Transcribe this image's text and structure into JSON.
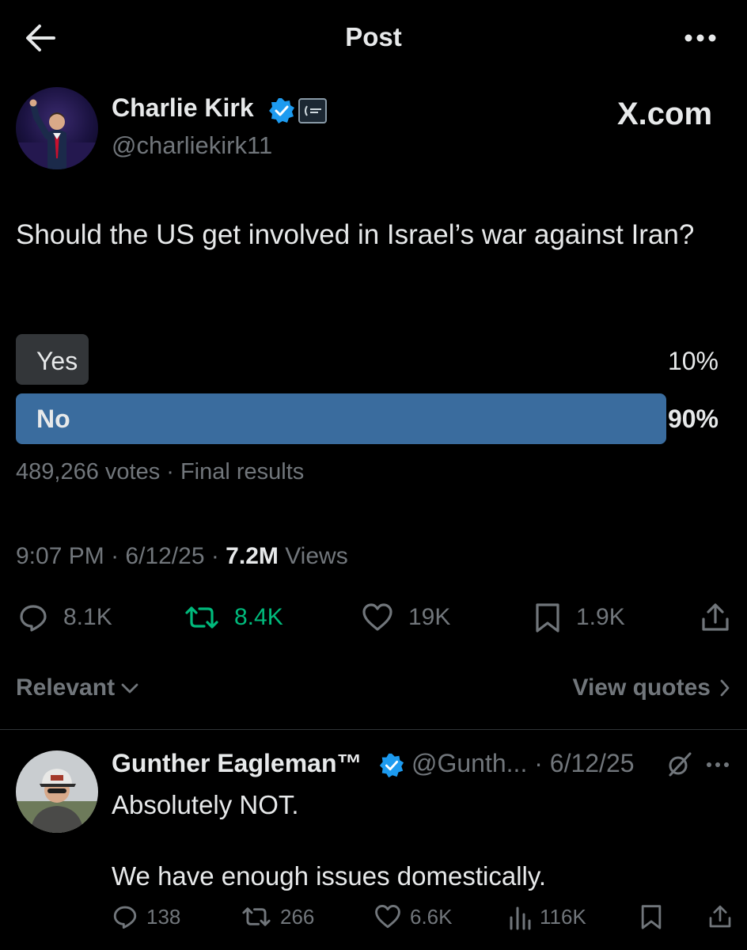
{
  "header": {
    "title": "Post"
  },
  "post": {
    "author_name": "Charlie Kirk",
    "author_handle": "@charliekirk11",
    "text": "Should the US get involved in Israel’s war against Iran?",
    "poll": {
      "options": [
        {
          "label": "Yes",
          "percent_text": "10%",
          "fraction": 0.1
        },
        {
          "label": "No",
          "percent_text": "90%",
          "fraction": 0.9
        }
      ],
      "meta": "489,266 votes · Final results"
    },
    "time": "9:07 PM",
    "date": "6/12/25",
    "views_count": "7.2M",
    "views_label": "Views",
    "actions": {
      "replies": "8.1K",
      "reposts": "8.4K",
      "likes": "19K",
      "bookmarks": "1.9K"
    }
  },
  "brand": "X.com",
  "sort": {
    "relevant_label": "Relevant",
    "view_quotes_label": "View quotes"
  },
  "reply": {
    "author_name": "Gunther Eagleman™",
    "handle_date": "@Gunth... · 6/12/25",
    "text": "Absolutely NOT.\n\nWe have enough issues domestically.",
    "actions": {
      "replies": "138",
      "reposts": "266",
      "likes": "6.6K",
      "views": "116K"
    }
  },
  "colors": {
    "poll_winner": "#3a6c9e",
    "poll_other": "#333639",
    "verified": "#1d9bf0",
    "repost_active": "#00ba7c",
    "muted": "#71767b"
  },
  "icons": [
    "back-arrow-icon",
    "more-icon",
    "verified-icon",
    "reply-icon",
    "repost-icon",
    "like-icon",
    "bookmark-icon",
    "share-icon",
    "views-icon",
    "grok-icon",
    "chevron-down-icon",
    "chevron-right-icon"
  ]
}
